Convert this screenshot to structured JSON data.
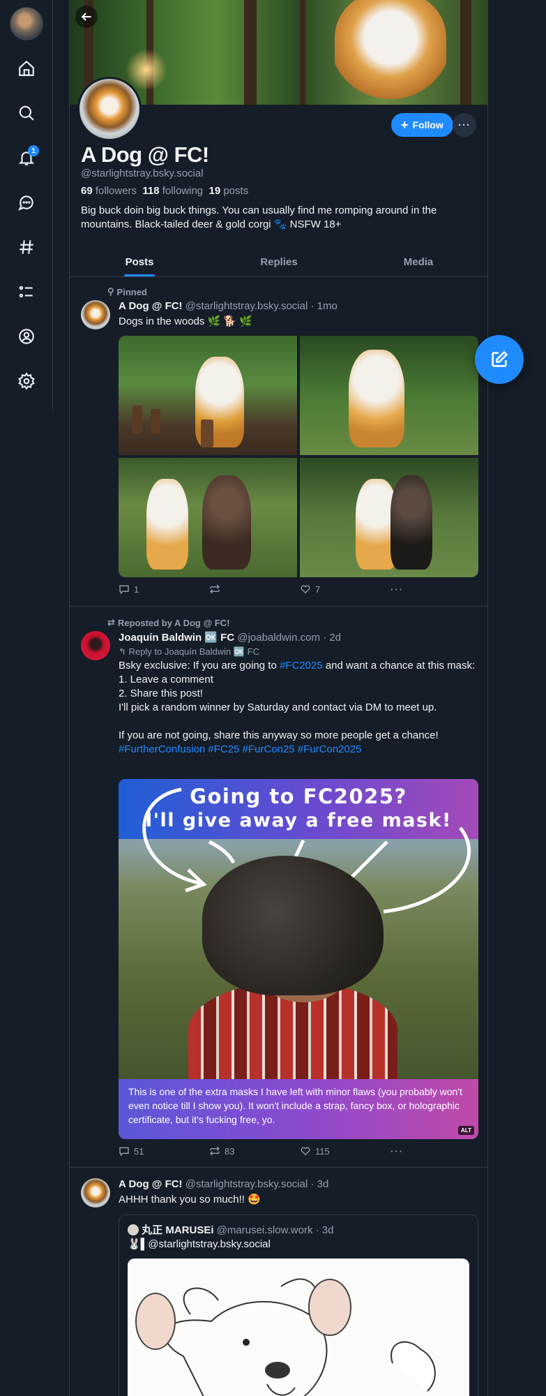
{
  "nav": {
    "notification_count": "1",
    "items": [
      "home-icon",
      "search-icon",
      "bell-icon",
      "chat-icon",
      "hashtag-icon",
      "list-icon",
      "profile-icon",
      "gear-icon"
    ]
  },
  "profile": {
    "display_name": "A Dog @ FC!",
    "handle": "@starlightstray.bsky.social",
    "followers_count": "69",
    "followers_label": "followers",
    "following_count": "118",
    "following_label": "following",
    "posts_count": "19",
    "posts_label": "posts",
    "bio": "Big buck doin big buck things. You can usually find me romping around in the mountains. Black-tailed deer & gold corgi 🐾 NSFW 18+",
    "follow_label": "Follow",
    "more_label": "···"
  },
  "tabs": [
    "Posts",
    "Replies",
    "Media"
  ],
  "posts": [
    {
      "meta": "Pinned",
      "author": "A Dog @ FC!",
      "handle": "@starlightstray.bsky.social",
      "time": "· 1mo",
      "text": "Dogs in the woods 🌿 🐕 🌿",
      "replies": "1",
      "reposts": "",
      "likes": "7"
    },
    {
      "meta": "Reposted by A Dog @ FC!",
      "author": "Joaquín Baldwin 🆗 FC",
      "handle": "@joabaldwin.com",
      "time": "· 2d",
      "reply_to": "Reply to Joaquín Baldwin 🆗 FC",
      "text_prefix": "Bsky exclusive: If you are going to ",
      "text_tag": "#FC2025",
      "text_suffix": " and want a chance at this mask:",
      "line1": "1. Leave a comment",
      "line2": "2. Share this post!",
      "line3": "I'll pick a random winner by Saturday and contact via DM to meet up.",
      "line4": "If you are not going, share this anyway so more people get a chance!",
      "tags": "#FurtherConfusion #FC25 #FurCon25 #FurCon2025",
      "image_title_1": "Going to FC2025?",
      "image_title_2": "I'll give away a free mask!",
      "image_caption": "This is one of the extra masks I have left with minor flaws (you probably won't even notice till I show you). It won't include a strap, fancy box, or holographic certificate, but it's fucking free, yo.",
      "alt_label": "ALT",
      "replies": "51",
      "reposts": "83",
      "likes": "115"
    },
    {
      "author": "A Dog @ FC!",
      "handle": "@starlightstray.bsky.social",
      "time": "· 3d",
      "text": "AHHH thank you so much!! 🤩",
      "quote_author": "丸正 MARUSEi",
      "quote_handle": "@marusei.slow.work",
      "quote_time": "· 3d",
      "quote_text": "🐰▌@starlightstray.bsky.social"
    }
  ],
  "colors": {
    "accent": "#208bfe",
    "background": "#151d28",
    "border": "#2e3b4c",
    "muted": "#93a0b0"
  }
}
